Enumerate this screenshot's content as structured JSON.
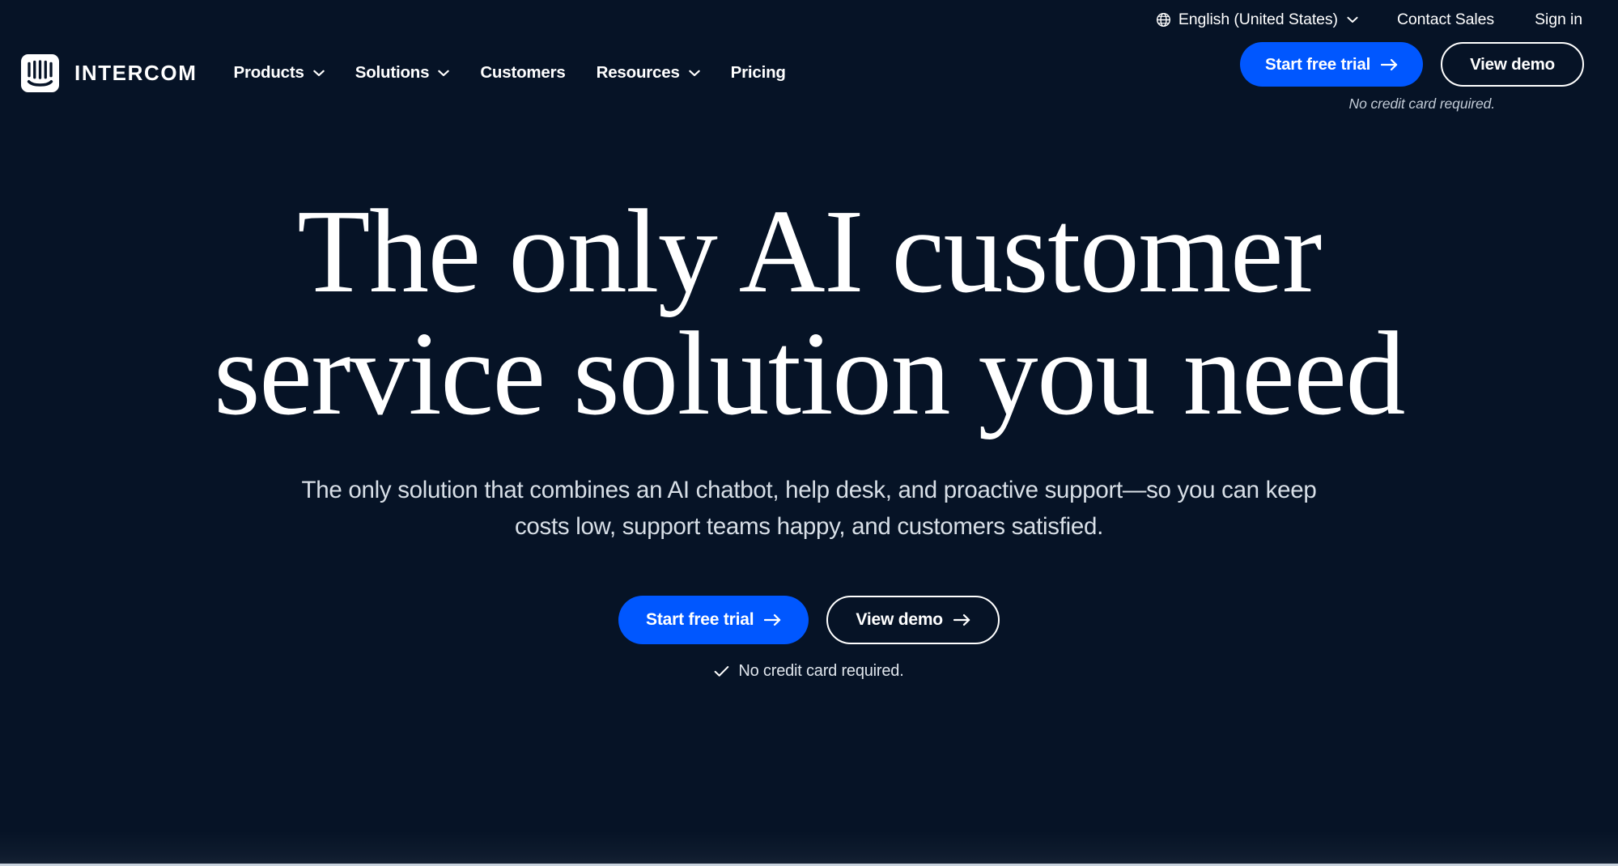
{
  "theme": {
    "background": "#061326",
    "accent_blue": "#0057FF",
    "text_primary": "#FFFFFF",
    "text_muted": "#D8DFE7"
  },
  "utility_bar": {
    "globe_icon": "globe-icon",
    "language": "English (United States)",
    "language_chevron": "chevron-down-icon",
    "contact_sales": "Contact Sales",
    "sign_in": "Sign in"
  },
  "nav": {
    "logo_icon": "intercom-logo-icon",
    "logo_text": "INTERCOM",
    "items": [
      {
        "label": "Products",
        "has_dropdown": true
      },
      {
        "label": "Solutions",
        "has_dropdown": true
      },
      {
        "label": "Customers",
        "has_dropdown": false
      },
      {
        "label": "Resources",
        "has_dropdown": true
      },
      {
        "label": "Pricing",
        "has_dropdown": false
      }
    ],
    "cta_primary": "Start free trial",
    "cta_secondary": "View demo",
    "note": "No credit card required."
  },
  "hero": {
    "title_line_1": "The only AI customer",
    "title_line_2": "service solution you need",
    "subtitle": "The only solution that combines an AI chatbot, help desk, and proactive support—so you can keep costs low, support teams happy, and customers satisfied.",
    "cta_primary": "Start free trial",
    "cta_secondary": "View demo",
    "note": "No credit card required.",
    "note_icon": "check-icon",
    "arrow_icon": "arrow-right-icon"
  }
}
